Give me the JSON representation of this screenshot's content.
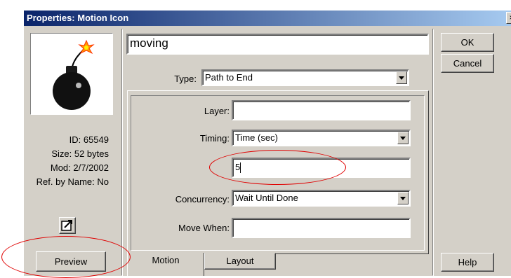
{
  "window": {
    "title": "Properties: Motion Icon",
    "close_glyph": "×"
  },
  "icon_info": {
    "id": "ID: 65549",
    "size": "Size: 52 bytes",
    "mod": "Mod: 2/7/2002",
    "ref": "Ref. by Name: No"
  },
  "name_field": {
    "value": "moving"
  },
  "type": {
    "label": "Type:",
    "value": "Path to End"
  },
  "motion_panel": {
    "layer_label": "Layer:",
    "layer_value": "",
    "timing_label": "Timing:",
    "timing_value": "Time (sec)",
    "timing_amount": "5",
    "concurrency_label": "Concurrency:",
    "concurrency_value": "Wait Until Done",
    "move_when_label": "Move When:",
    "move_when_value": ""
  },
  "tabs": [
    {
      "label": "Motion"
    },
    {
      "label": "Layout"
    }
  ],
  "buttons": {
    "ok": "OK",
    "cancel": "Cancel",
    "help": "Help",
    "preview": "Preview"
  },
  "colors": {
    "title_gradient_start": "#0a246a",
    "annotation": "#e00000"
  }
}
